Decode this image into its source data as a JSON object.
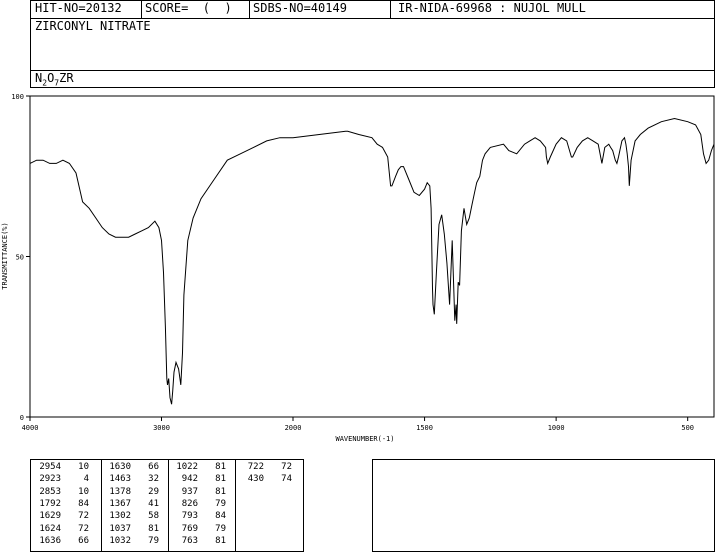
{
  "header": {
    "hit_no": "HIT-NO=20132",
    "score": "SCORE=  (  )",
    "sdbs_no": "SDBS-NO=40149",
    "ir_id": "IR-NIDA-69968 : NUJOL MULL"
  },
  "compound_name": "ZIRCONYL NITRATE",
  "formula": {
    "parts": [
      "N",
      "2",
      "O",
      "7",
      "ZR"
    ]
  },
  "chart_data": {
    "type": "line",
    "xlabel": "WAVENUMBER(-1)",
    "ylabel": "TRANSMITTANCE(%)",
    "xlim": [
      4000,
      400
    ],
    "ylim": [
      0,
      100
    ],
    "x_ticks": [
      4000,
      3000,
      2000,
      1500,
      1000,
      500
    ],
    "y_ticks": [
      0,
      50,
      100
    ],
    "series": [
      {
        "x": [
          4000,
          3950,
          3900,
          3850,
          3800,
          3750,
          3700,
          3650,
          3600,
          3550,
          3500,
          3450,
          3400,
          3350,
          3300,
          3250,
          3200,
          3150,
          3100,
          3050,
          3020,
          3000,
          2985,
          2970,
          2960,
          2954,
          2945,
          2935,
          2923,
          2915,
          2905,
          2890,
          2870,
          2853,
          2840,
          2830,
          2800,
          2760,
          2700,
          2600,
          2500,
          2400,
          2300,
          2200,
          2100,
          2000,
          1900,
          1800,
          1792,
          1750,
          1700,
          1680,
          1660,
          1640,
          1629,
          1624,
          1610,
          1600,
          1590,
          1580,
          1560,
          1540,
          1520,
          1500,
          1490,
          1480,
          1475,
          1470,
          1468,
          1463,
          1455,
          1445,
          1435,
          1425,
          1415,
          1405,
          1395,
          1385,
          1380,
          1378,
          1372,
          1367,
          1360,
          1350,
          1340,
          1330,
          1320,
          1310,
          1302,
          1290,
          1280,
          1270,
          1250,
          1200,
          1180,
          1150,
          1120,
          1100,
          1080,
          1060,
          1040,
          1037,
          1032,
          1022,
          1000,
          980,
          960,
          942,
          937,
          920,
          900,
          880,
          860,
          840,
          826,
          815,
          800,
          793,
          785,
          775,
          769,
          763,
          750,
          740,
          735,
          730,
          725,
          722,
          715,
          700,
          680,
          650,
          600,
          550,
          500,
          470,
          450,
          440,
          430,
          420,
          410,
          400
        ],
        "y": [
          79,
          80,
          80,
          79,
          79,
          80,
          79,
          76,
          67,
          65,
          62,
          59,
          57,
          56,
          56,
          56,
          57,
          58,
          59,
          61,
          59,
          55,
          45,
          28,
          12,
          10,
          12,
          6,
          4,
          8,
          14,
          17,
          15,
          10,
          20,
          38,
          55,
          62,
          68,
          74,
          80,
          82,
          84,
          86,
          87,
          87,
          88,
          89,
          89,
          88,
          87,
          85,
          84,
          81,
          72,
          72,
          75,
          77,
          78,
          78,
          74,
          70,
          69,
          71,
          73,
          72,
          65,
          40,
          35,
          32,
          45,
          60,
          63,
          57,
          48,
          35,
          55,
          30,
          35,
          29,
          42,
          41,
          58,
          65,
          60,
          62,
          66,
          70,
          73,
          75,
          80,
          82,
          84,
          85,
          83,
          82,
          85,
          86,
          87,
          86,
          84,
          81,
          79,
          81,
          85,
          87,
          86,
          81,
          81,
          84,
          86,
          87,
          86,
          85,
          79,
          84,
          85,
          84,
          83,
          80,
          79,
          81,
          86,
          87,
          85,
          82,
          78,
          72,
          80,
          86,
          88,
          90,
          92,
          93,
          92,
          91,
          88,
          82,
          79,
          80,
          83,
          85
        ]
      }
    ],
    "peak_table": [
      [
        [
          "2954",
          "10"
        ],
        [
          "2923",
          "4"
        ],
        [
          "2853",
          "10"
        ],
        [
          "1792",
          "84"
        ],
        [
          "1629",
          "72"
        ],
        [
          "1624",
          "72"
        ],
        [
          "1636",
          "66"
        ]
      ],
      [
        [
          "1630",
          "66"
        ],
        [
          "1463",
          "32"
        ],
        [
          "1378",
          "29"
        ],
        [
          "1367",
          "41"
        ],
        [
          "1302",
          "58"
        ],
        [
          "1037",
          "81"
        ],
        [
          "1032",
          "79"
        ]
      ],
      [
        [
          "1022",
          "81"
        ],
        [
          "942",
          "81"
        ],
        [
          "937",
          "81"
        ],
        [
          "826",
          "79"
        ],
        [
          "793",
          "84"
        ],
        [
          "769",
          "79"
        ],
        [
          "763",
          "81"
        ]
      ],
      [
        [
          "722",
          "72"
        ],
        [
          "430",
          "74"
        ]
      ]
    ]
  }
}
